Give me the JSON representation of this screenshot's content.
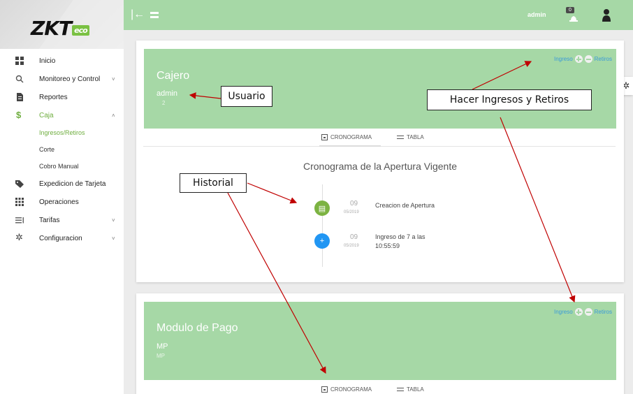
{
  "sidebar": {
    "brand": {
      "zk": "ZK",
      "t": "T",
      "eco": "eco"
    },
    "items": [
      {
        "label": "Inicio",
        "icon": "grid-icon"
      },
      {
        "label": "Monitoreo y Control",
        "icon": "search-icon",
        "chevron": "˅"
      },
      {
        "label": "Reportes",
        "icon": "document-icon"
      },
      {
        "label": "Caja",
        "icon": "dollar-icon",
        "chevron": "˄"
      },
      {
        "label": "Expedicion de Tarjeta",
        "icon": "tag-icon"
      },
      {
        "label": "Operaciones",
        "icon": "apps-icon"
      },
      {
        "label": "Tarifas",
        "icon": "list-icon",
        "chevron": "˅"
      },
      {
        "label": "Configuracion",
        "icon": "gear-icon",
        "chevron": "˅"
      }
    ],
    "caja_sub": [
      "Ingresos/Retiros",
      "Corte",
      "Cobro Manual"
    ]
  },
  "topbar": {
    "user": "admin",
    "badge": "0"
  },
  "card1": {
    "title": "Cajero",
    "user": "admin",
    "user_sub": "2",
    "ingreso": "Ingreso",
    "retiros": "Retiros",
    "tab_crono": "CRONOGRAMA",
    "tab_tabla": "TABLA",
    "crono_title": "Cronograma de la Apertura Vigente",
    "events": [
      {
        "day": "09",
        "month": "05/2019",
        "text": "Creacion de Apertura",
        "color": "#7cb342",
        "glyph": "▤"
      },
      {
        "day": "09",
        "month": "05/2019",
        "text": "Ingreso de 7 a las",
        "text2": "10:55:59",
        "color": "#2196f3",
        "glyph": "+"
      }
    ]
  },
  "card2": {
    "title": "Modulo de Pago",
    "code": "MP",
    "code_sub": "MP",
    "ingreso": "Ingreso",
    "retiros": "Retiros",
    "tab_crono": "CRONOGRAMA",
    "tab_tabla": "TABLA"
  },
  "annotations": {
    "usuario": "Usuario",
    "hacer": "Hacer Ingresos y Retiros",
    "historial": "Historial"
  },
  "colors": {
    "accent": "#a6d8a6",
    "active": "#6fae3f",
    "arrow": "#c00000"
  }
}
